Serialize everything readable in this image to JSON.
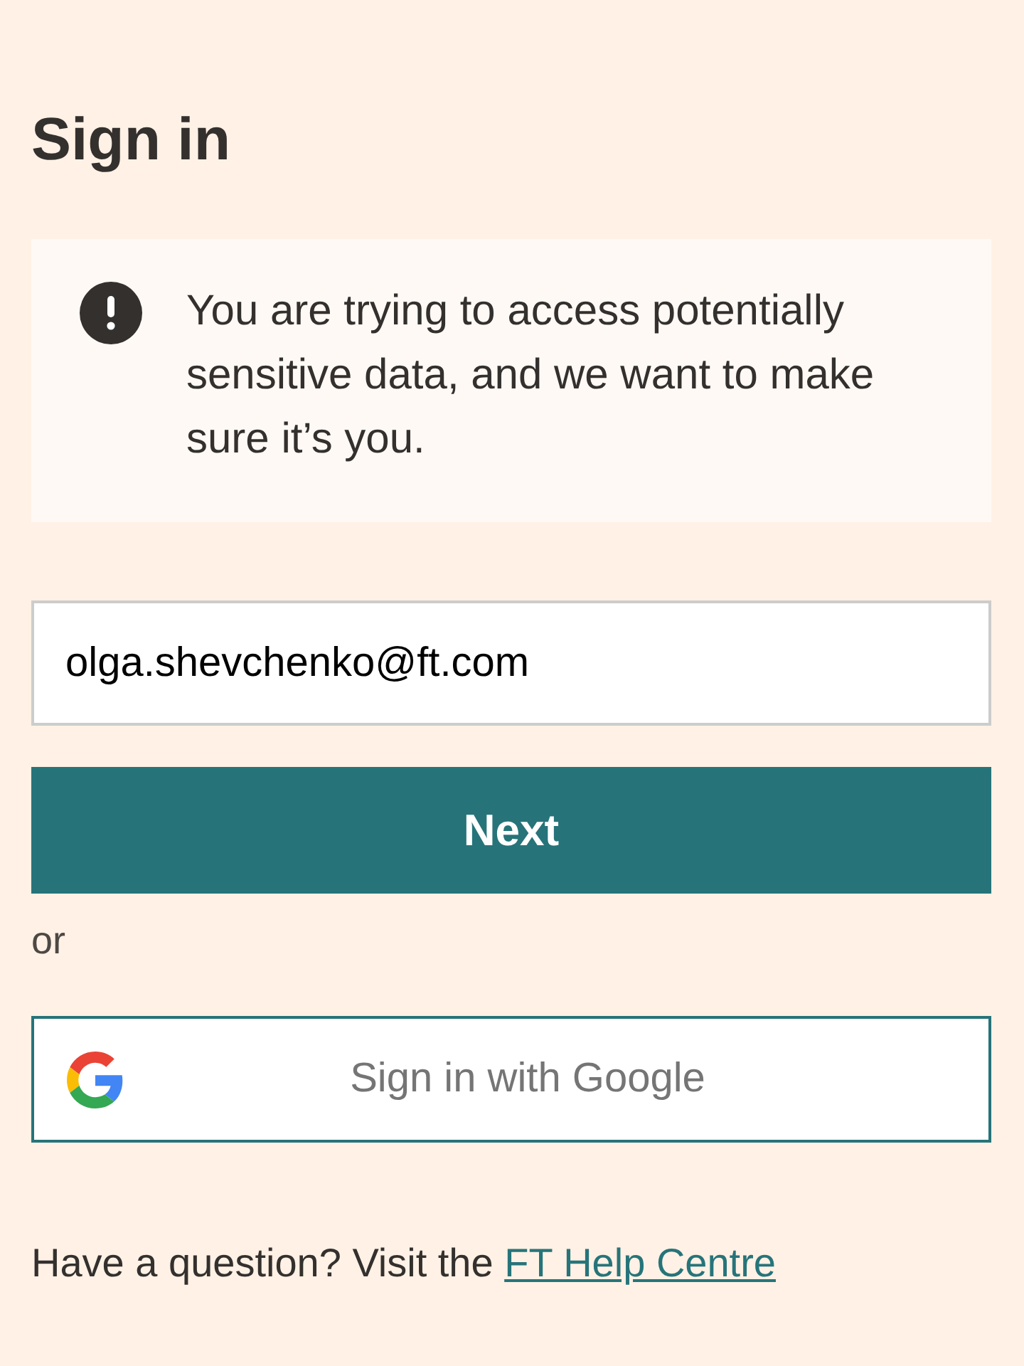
{
  "title": "Sign in",
  "alert": {
    "message": "You are trying to access potentially sensitive data, and we want to make sure it’s you."
  },
  "email_field": {
    "value": "olga.shevchenko@ft.com"
  },
  "next_button": {
    "label": "Next"
  },
  "separator": "or",
  "google_button": {
    "label": "Sign in with Google"
  },
  "help": {
    "text": "Have a question? Visit the",
    "link": "FT Help Centre"
  }
}
